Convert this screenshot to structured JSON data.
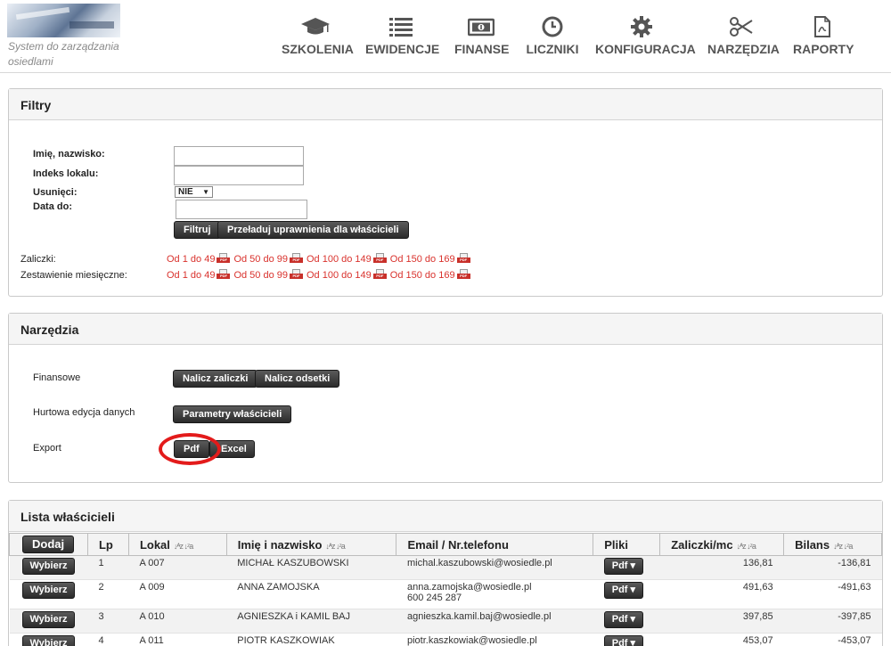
{
  "app": {
    "tagline": "System do zarządzania osiedlami"
  },
  "nav": [
    {
      "label": "SZKOLENIA",
      "icon": "graduation-cap-icon"
    },
    {
      "label": "EWIDENCJE",
      "icon": "list-icon"
    },
    {
      "label": "FINANSE",
      "icon": "money-icon"
    },
    {
      "label": "LICZNIKI",
      "icon": "clock-icon"
    },
    {
      "label": "KONFIGURACJA",
      "icon": "gear-icon"
    },
    {
      "label": "NARZĘDZIA",
      "icon": "scissors-icon"
    },
    {
      "label": "RAPORTY",
      "icon": "pdf-file-icon"
    }
  ],
  "filters": {
    "title": "Filtry",
    "name_label": "Imię, nazwisko:",
    "name_value": "",
    "index_label": "Indeks lokalu:",
    "index_value": "",
    "deleted_label": "Usunięci:",
    "deleted_value": "NIE",
    "date_label": "Data do:",
    "date_value": "",
    "filter_button": "Filtruj",
    "reload_button": "Przeładuj uprawnienia dla właścicieli",
    "advances_label": "Zaliczki:",
    "monthly_label": "Zestawienie miesięczne:",
    "ranges": [
      "Od 1 do 49",
      "Od 50 do 99",
      "Od 100 do 149",
      "Od 150 do 169"
    ],
    "pdf_badge": "PDF"
  },
  "tools": {
    "title": "Narzędzia",
    "finance_label": "Finansowe",
    "charge_advances": "Nalicz zaliczki",
    "charge_interest": "Nalicz odsetki",
    "bulk_label": "Hurtowa edycja danych",
    "owner_params": "Parametry właścicieli",
    "export_label": "Export",
    "pdf_button": "Pdf",
    "excel_button": "Excel"
  },
  "owners": {
    "title": "Lista właścicieli",
    "add_button": "Dodaj",
    "sort_glyphs": "↓ᴬz ↓ᶻa",
    "columns": {
      "lp": "Lp",
      "lokal": "Lokal",
      "name": "Imię i nazwisko",
      "contact": "Email / Nr.telefonu",
      "files": "Pliki",
      "advances": "Zaliczki/mc",
      "balance": "Bilans"
    },
    "select_button": "Wybierz",
    "pdf_button": "Pdf ▾",
    "rows": [
      {
        "lp": "1",
        "lokal": "A 007",
        "name": "MICHAŁ KASZUBOWSKI",
        "email": "michal.kaszubowski@wosiedle.pl",
        "phone": "",
        "advances": "136,81",
        "balance": "-136,81"
      },
      {
        "lp": "2",
        "lokal": "A 009",
        "name": "ANNA ZAMOJSKA",
        "email": "anna.zamojska@wosiedle.pl",
        "phone": "600 245 287",
        "advances": "491,63",
        "balance": "-491,63"
      },
      {
        "lp": "3",
        "lokal": "A 010",
        "name": "AGNIESZKA i KAMIL BAJ",
        "email": "agnieszka.kamil.baj@wosiedle.pl",
        "phone": "",
        "advances": "397,85",
        "balance": "-397,85"
      },
      {
        "lp": "4",
        "lokal": "A 011",
        "name": "PIOTR KASZKOWIAK",
        "email": "piotr.kaszkowiak@wosiedle.pl",
        "phone": "",
        "advances": "453,07",
        "balance": "-453,07"
      }
    ]
  },
  "colors": {
    "accent_red": "#d9322d",
    "highlight": "#e31b1b"
  }
}
